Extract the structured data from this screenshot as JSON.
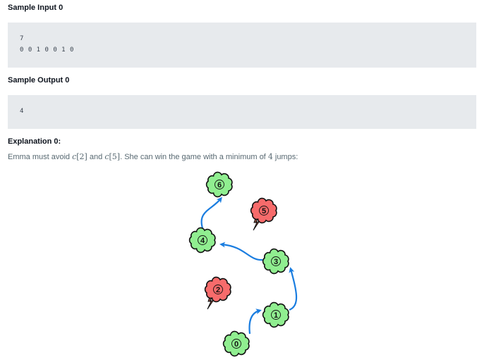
{
  "sample_input": {
    "heading": "Sample Input 0",
    "lines": [
      "7",
      "0 0 1 0 0 1 0"
    ]
  },
  "sample_output": {
    "heading": "Sample Output 0",
    "lines": [
      "4"
    ]
  },
  "explanation": {
    "heading": "Explanation 0:",
    "text_before": "Emma must avoid ",
    "c1_var": "c",
    "c1_index": "[2]",
    "text_and": " and ",
    "c2_var": "c",
    "c2_index": "[5]",
    "text_middle": ". She can win the game with a minimum of ",
    "jumps_num": "4",
    "text_after": " jumps:"
  },
  "diagram": {
    "colors": {
      "safe": "#90ee90",
      "thunder": "#f76b6b",
      "arrow": "#1a7de0",
      "outline": "#111111"
    },
    "clouds": [
      {
        "label": "6",
        "kind": "safe"
      },
      {
        "label": "5",
        "kind": "thunder"
      },
      {
        "label": "4",
        "kind": "safe"
      },
      {
        "label": "3",
        "kind": "safe"
      },
      {
        "label": "2",
        "kind": "thunder"
      },
      {
        "label": "1",
        "kind": "safe"
      },
      {
        "label": "0",
        "kind": "safe"
      }
    ]
  }
}
